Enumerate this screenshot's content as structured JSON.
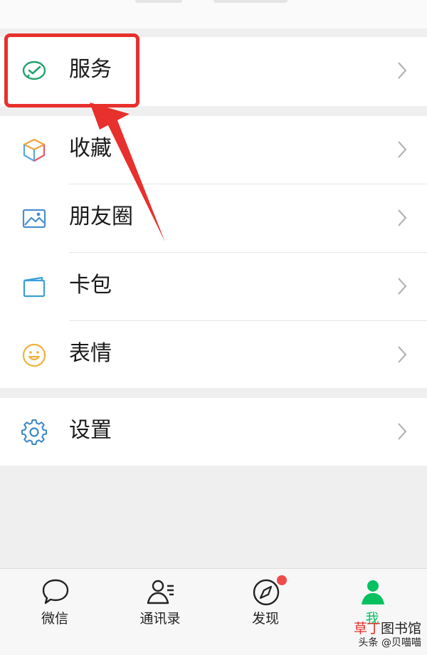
{
  "menu": {
    "items": [
      {
        "label": "服务",
        "icon": "wechat-pay-icon"
      },
      {
        "label": "收藏",
        "icon": "cube-icon"
      },
      {
        "label": "朋友圈",
        "icon": "photo-icon"
      },
      {
        "label": "卡包",
        "icon": "card-wallet-icon"
      },
      {
        "label": "表情",
        "icon": "smiley-icon"
      },
      {
        "label": "设置",
        "icon": "gear-icon"
      }
    ]
  },
  "tabbar": {
    "tabs": [
      {
        "label": "微信",
        "icon": "chat-bubble-icon"
      },
      {
        "label": "通讯录",
        "icon": "contacts-icon"
      },
      {
        "label": "发现",
        "icon": "compass-icon",
        "badge_dot": true
      },
      {
        "label": "我",
        "icon": "person-icon",
        "active": true
      }
    ]
  },
  "watermark": {
    "line1_a": "草丁",
    "line1_b": "图书馆",
    "line2": "头条 @贝喵喵"
  },
  "colors": {
    "accent_green": "#07c160",
    "highlight_red": "#e8302d",
    "badge_red": "#f04b4b"
  }
}
